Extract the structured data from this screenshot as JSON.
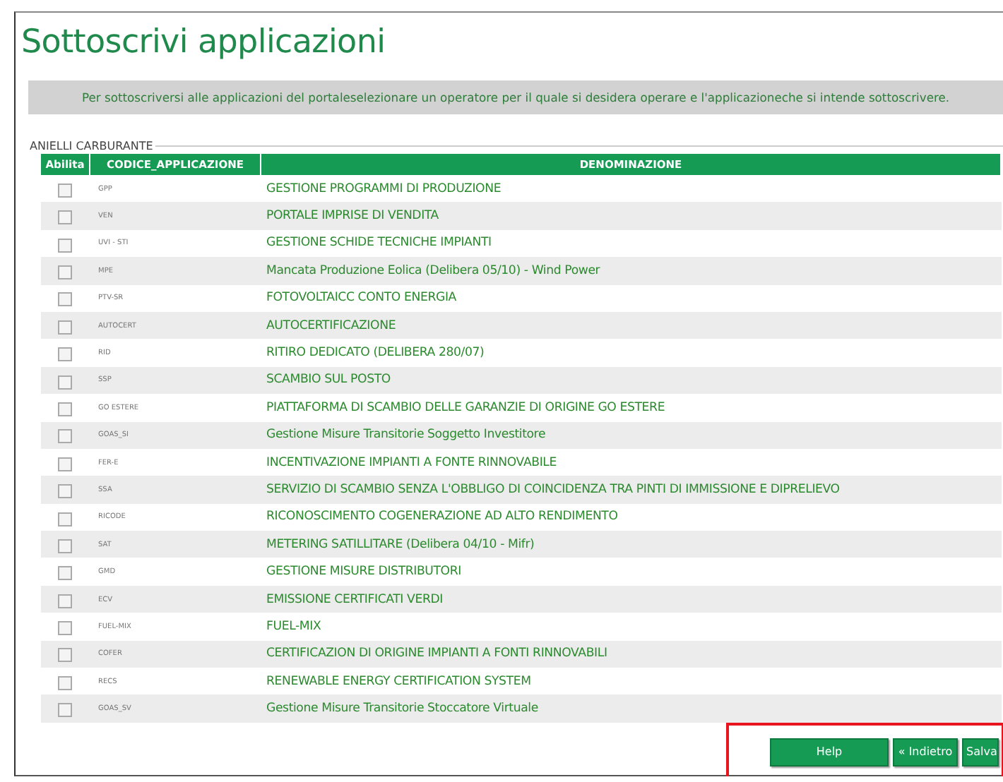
{
  "title": "Sottoscrivi applicazioni",
  "info": "Per sottoscriversi alle applicazioni del portaleselezionare un operatore per il quale si desidera operare e l'applicazioneche si intende sottoscrivere.",
  "section": "ANIELLI CARBURANTE",
  "table": {
    "columns": [
      "Abilita",
      "CODICE_APPLICAZIONE",
      "DENOMINAZIONE"
    ],
    "rows": [
      {
        "code": "GPP",
        "name": "GESTIONE PROGRAMMI DI PRODUZIONE",
        "checked": false
      },
      {
        "code": "VEN",
        "name": "PORTALE IMPRISE DI VENDITA",
        "checked": false
      },
      {
        "code": "UVI - STI",
        "name": "GESTIONE SCHIDE TECNICHE IMPIANTI",
        "checked": false
      },
      {
        "code": "MPE",
        "name": "Mancata Produzione Eolica (Delibera 05/10) - Wind Power",
        "checked": false
      },
      {
        "code": "PTV-SR",
        "name": "FOTOVOLTAICC CONTO ENERGIA",
        "checked": false
      },
      {
        "code": "AUTOCERT",
        "name": "AUTOCERTIFICAZIONE",
        "checked": false
      },
      {
        "code": "RID",
        "name": "RITIRO DEDICATO (DELIBERA 280/07)",
        "checked": false
      },
      {
        "code": "SSP",
        "name": "SCAMBIO SUL POSTO",
        "checked": false
      },
      {
        "code": "GO ESTERE",
        "name": "PIATTAFORMA DI SCAMBIO DELLE GARANZIE DI ORIGINE GO ESTERE",
        "checked": false
      },
      {
        "code": "GOAS_SI",
        "name": "Gestione Misure Transitorie Soggetto Investitore",
        "checked": false
      },
      {
        "code": "FER-E",
        "name": "INCENTIVAZIONE IMPIANTI A FONTE RINNOVABILE",
        "checked": false
      },
      {
        "code": "SSA",
        "name": "SERVIZIO DI SCAMBIO SENZA L'OBBLIGO DI COINCIDENZA TRA PINTI DI IMMISSIONE E DIPRELIEVO",
        "checked": false
      },
      {
        "code": "RICODE",
        "name": "RICONOSCIMENTO COGENERAZIONE AD ALTO RENDIMENTO",
        "checked": false
      },
      {
        "code": "SAT",
        "name": "METERING SATILLITARE (Delibera 04/10 - Mifr)",
        "checked": false
      },
      {
        "code": "GMD",
        "name": "GESTIONE MISURE DISTRIBUTORI",
        "checked": false
      },
      {
        "code": "ECV",
        "name": "EMISSIONE CERTIFICATI VERDI",
        "checked": false
      },
      {
        "code": "FUEL-MIX",
        "name": "FUEL-MIX",
        "checked": false
      },
      {
        "code": "COFER",
        "name": "CERTIFICAZION DI ORIGINE IMPIANTI A FONTI RINNOVABILI",
        "checked": false
      },
      {
        "code": "RECS",
        "name": "RENEWABLE ENERGY CERTIFICATION SYSTEM",
        "checked": false
      },
      {
        "code": "GOAS_SV",
        "name": "Gestione Misure Transitorie Stoccatore Virtuale",
        "checked": false
      }
    ]
  },
  "buttons": [
    "Help",
    "« Indietro",
    "Salva"
  ]
}
